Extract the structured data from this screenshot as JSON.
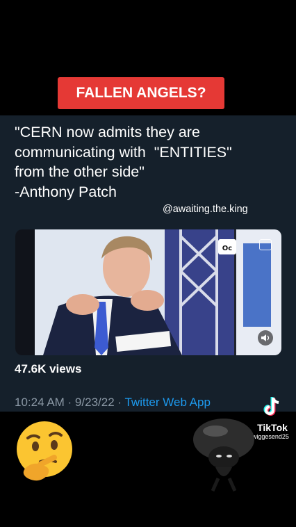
{
  "overlay": {
    "badge_text": "FALLEN ANGELS?",
    "tiktok_brand": "TikTok",
    "tiktok_user": "@sh@ewiggesend25"
  },
  "tweet": {
    "quote_lines": [
      "\"CERN now admits they are",
      "communicating with  \"ENTITIES\"",
      "from the other side\"",
      "-Anthony Patch"
    ],
    "watermark_handle": "@awaiting.the.king",
    "views": "47.6K views",
    "timestamp": "10:24 AM · 9/23/22 · ",
    "source": "Twitter Web App"
  },
  "icons": {
    "video_mute": "speaker-icon",
    "video_corner": "pip-icon",
    "tiktok_logo": "tiktok-logo-icon",
    "emoji": "thinking-face-emoji",
    "avatar": "dark-character-avatar"
  },
  "colors": {
    "badge_bg": "#e53935",
    "card_bg": "#15202b",
    "link": "#1d9bf0",
    "muted": "#8b98a5"
  }
}
